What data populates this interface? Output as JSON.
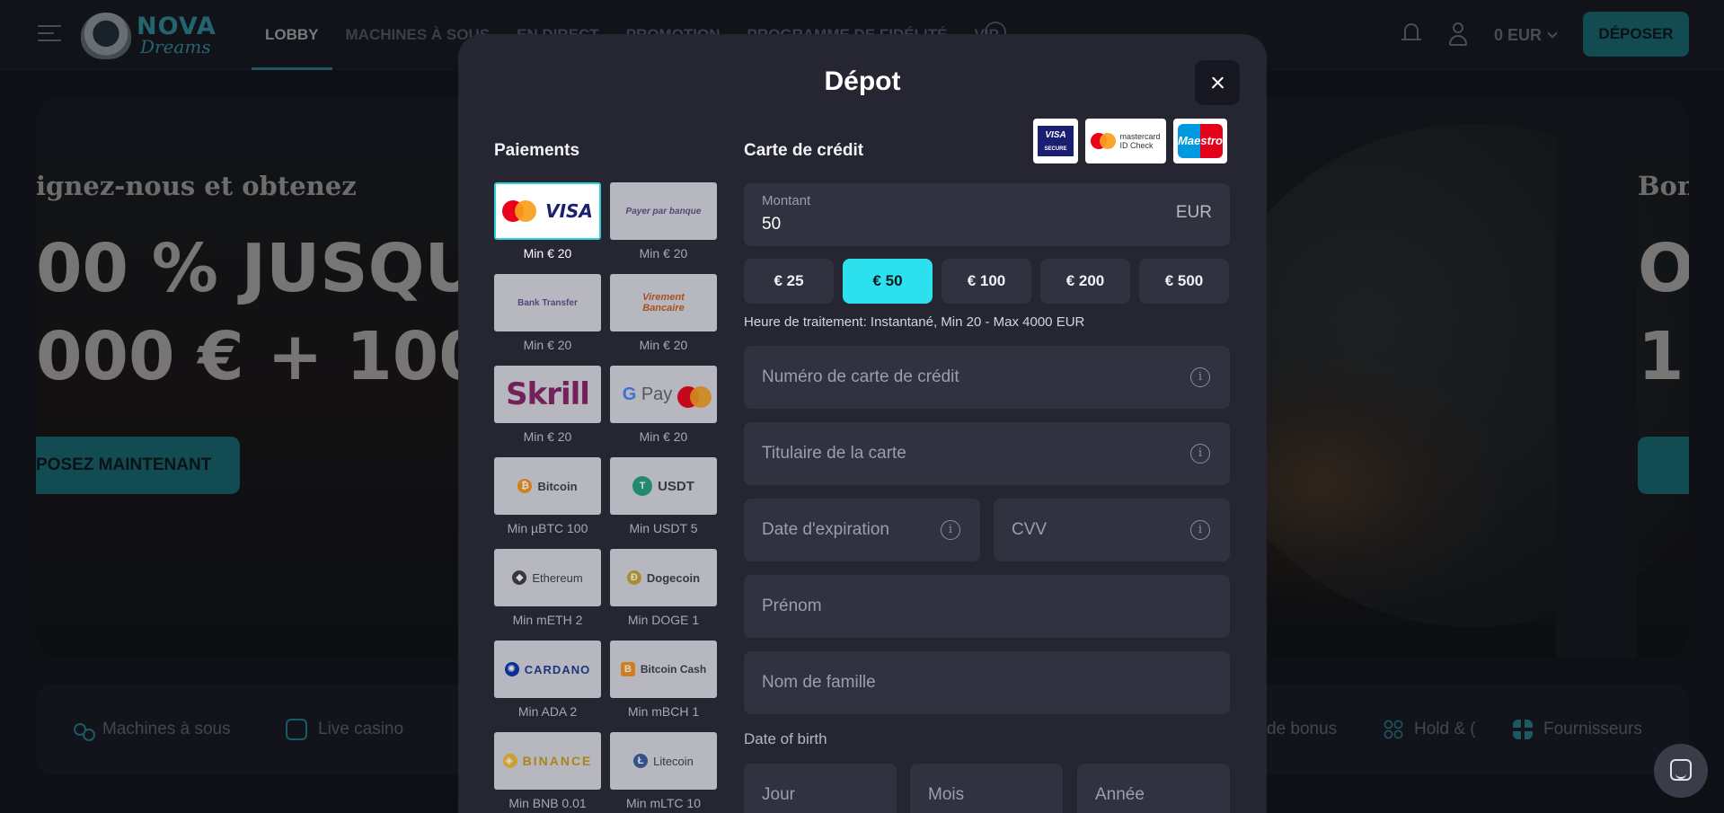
{
  "site": {
    "logo_top": "NOVA",
    "logo_bottom": "Dreams",
    "nav": [
      "LOBBY",
      "MACHINES À SOUS",
      "EN DIRECT",
      "PROMOTION",
      "PROGRAMME DE FIDÉLITÉ",
      "VIP"
    ],
    "balance": "0 EUR",
    "deposit_label": "DÉPOSER"
  },
  "hero": {
    "subtitle": "ignez-nous et obtenez",
    "line1": "00 % JUSQU",
    "line2": "000 € + 100",
    "cta": "POSEZ MAINTENANT",
    "right_subtitle": "Bonu",
    "right_line1": "O",
    "right_line2": "1("
  },
  "categories": {
    "slots": "Machines à sous",
    "live": "Live casino",
    "bonus": "de bonus",
    "hold": "Hold & (",
    "providers": "Fournisseurs"
  },
  "modal": {
    "title": "Dépot",
    "payments_title": "Paiements",
    "card_title": "Carte de crédit",
    "badges": {
      "visa": "VISA",
      "visa_sub": "SECURE",
      "mc_line1": "mastercard",
      "mc_line2": "ID Check",
      "maestro": "Maestro"
    },
    "methods": [
      {
        "name": "mastercard-visa",
        "min": "Min € 20"
      },
      {
        "name": "payer-par-banque",
        "label": "Payer par banque",
        "min": "Min € 20"
      },
      {
        "name": "bank-transfer",
        "label": "Bank Transfer",
        "min": "Min € 20"
      },
      {
        "name": "virement-bancaire",
        "label": "Virement Bancaire",
        "min": "Min € 20"
      },
      {
        "name": "skrill",
        "label": "Skrill",
        "min": "Min € 20"
      },
      {
        "name": "gpay",
        "label": "Pay",
        "min": "Min € 20"
      },
      {
        "name": "bitcoin",
        "label": "Bitcoin",
        "min": "Min µBTC 100"
      },
      {
        "name": "usdt",
        "label": "USDT",
        "min": "Min USDT 5"
      },
      {
        "name": "ethereum",
        "label": "Ethereum",
        "min": "Min mETH 2"
      },
      {
        "name": "dogecoin",
        "label": "Dogecoin",
        "min": "Min DOGE 1"
      },
      {
        "name": "cardano",
        "label": "CARDANO",
        "min": "Min ADA 2"
      },
      {
        "name": "bitcoin-cash",
        "label": "Bitcoin Cash",
        "min": "Min mBCH 1"
      },
      {
        "name": "binance",
        "label": "BINANCE",
        "min": "Min BNB 0.01"
      },
      {
        "name": "litecoin",
        "label": "Litecoin",
        "min": "Min mLTC 10"
      }
    ],
    "amount": {
      "label": "Montant",
      "value": "50",
      "currency": "EUR"
    },
    "quick_amounts": [
      "€ 25",
      "€ 50",
      "€ 100",
      "€ 200",
      "€ 500"
    ],
    "selected_quick_amount": "€ 50",
    "processing": "Heure de traitement: Instantané, Min 20 - Max 4000 EUR",
    "fields": {
      "card_number": "Numéro de carte de crédit",
      "holder": "Titulaire de la carte",
      "expiry": "Date d'expiration",
      "cvv": "CVV",
      "first_name": "Prénom",
      "last_name": "Nom de famille"
    },
    "dob": {
      "label": "Date of birth",
      "day": "Jour",
      "month": "Mois",
      "year": "Année"
    }
  },
  "colors": {
    "accent": "#2ce0ee",
    "brand": "#1e8d99",
    "modal_bg": "#252632",
    "field_bg": "#303240"
  }
}
